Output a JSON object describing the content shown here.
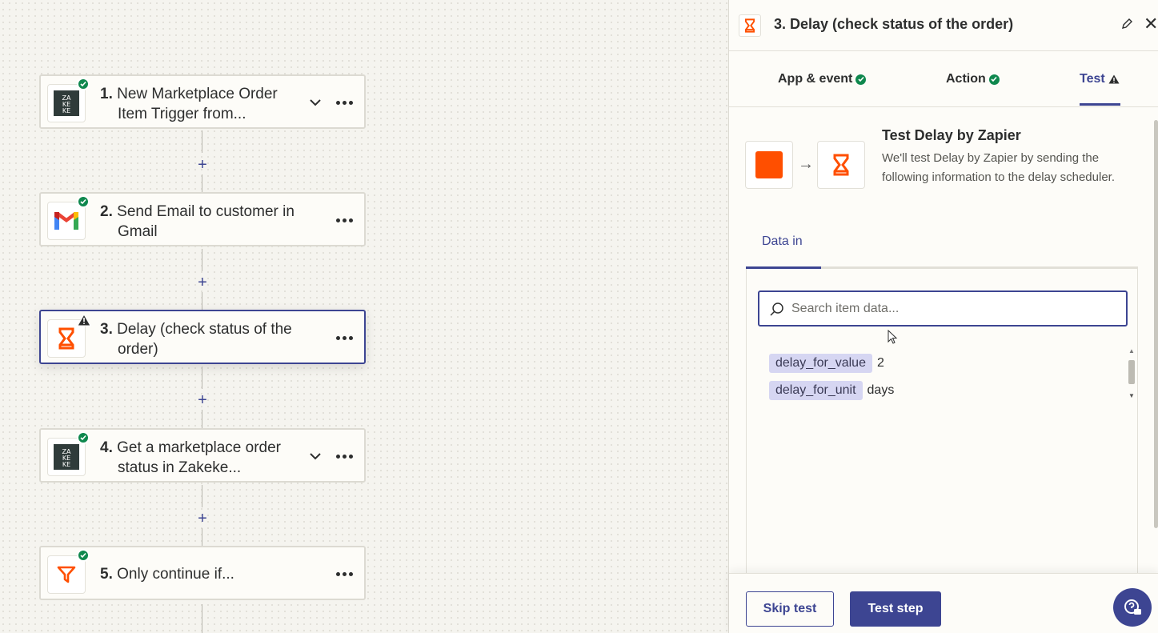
{
  "steps": [
    {
      "number": "1.",
      "line1": "New Marketplace Order",
      "line2": "Item Trigger from...",
      "status": "ok",
      "app": "zakeke",
      "has_chevron": true
    },
    {
      "number": "2.",
      "line1": "Send Email to customer in",
      "line2": "Gmail",
      "status": "ok",
      "app": "gmail",
      "has_chevron": false
    },
    {
      "number": "3.",
      "line1": "Delay (check status of the",
      "line2": "order)",
      "status": "warning",
      "app": "delay",
      "has_chevron": false
    },
    {
      "number": "4.",
      "line1": "Get a marketplace order",
      "line2": "status in Zakeke...",
      "status": "ok",
      "app": "zakeke",
      "has_chevron": true
    },
    {
      "number": "5.",
      "line1": "Only continue if...",
      "line2": "",
      "status": "ok",
      "app": "filter",
      "has_chevron": false
    }
  ],
  "add_step_symbol": "+",
  "panel": {
    "title": "3. Delay (check status of the order)",
    "tabs": [
      {
        "label": "App & event",
        "status": "ok"
      },
      {
        "label": "Action",
        "status": "ok"
      },
      {
        "label": "Test",
        "status": "warning",
        "active": true
      }
    ],
    "test_title": "Test Delay by Zapier",
    "test_description": "We'll test Delay by Zapier by sending the following information to the delay scheduler.",
    "data_in_tab": "Data in",
    "search_placeholder": "Search item data...",
    "data_items": [
      {
        "key": "delay_for_value",
        "value": "2"
      },
      {
        "key": "delay_for_unit",
        "value": "days"
      }
    ],
    "skip_label": "Skip test",
    "test_step_label": "Test step"
  },
  "colors": {
    "accent": "#3d4592",
    "success": "#0f884e",
    "zapier_orange": "#ff4f00",
    "key_chip": "#d6d6f2"
  },
  "icons": [
    "zakeke-logo-icon",
    "gmail-icon",
    "hourglass-icon",
    "filter-icon",
    "check-icon",
    "warning-icon",
    "chevron-down-icon",
    "more-icon",
    "pencil-icon",
    "close-icon",
    "search-icon",
    "arrow-right-icon",
    "help-icon"
  ]
}
